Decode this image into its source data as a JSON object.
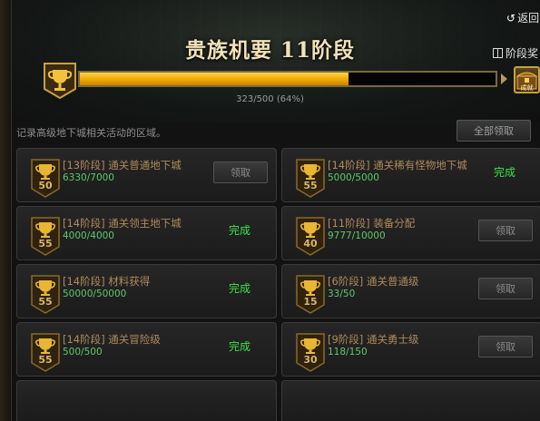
{
  "header": {
    "back_label": "返回",
    "back_icon": "return-arrow-icon",
    "title": "贵族机要 11阶段",
    "stage_reward_label": "阶段奖",
    "stage_reward_icon": "gift-icon"
  },
  "progress": {
    "current": 323,
    "total": 500,
    "fraction": 0.646,
    "text": "323/500 (64%)",
    "reward_box_label": "成就"
  },
  "description": "记录高级地下城相关活动的区域。",
  "claim_all_label": "全部领取",
  "colors": {
    "gold": "#f0a800",
    "done_green": "#3ee04a",
    "count_green": "#5ec86a",
    "name_brown": "#b08a5a"
  },
  "achievements": [
    {
      "level": "50",
      "name": "[13阶段] 通关普通地下城",
      "count": "6330/7000",
      "status": "领取"
    },
    {
      "level": "55",
      "name": "[14阶段] 通关稀有怪物地下城",
      "count": "5000/5000",
      "status": "完成"
    },
    {
      "level": "55",
      "name": "[14阶段] 通关领主地下城",
      "count": "4000/4000",
      "status": "完成"
    },
    {
      "level": "40",
      "name": "[11阶段] 装备分配",
      "count": "9777/10000",
      "status": "领取"
    },
    {
      "level": "55",
      "name": "[14阶段] 材料获得",
      "count": "50000/50000",
      "status": "完成"
    },
    {
      "level": "15",
      "name": "[6阶段] 通关普通级",
      "count": "33/50",
      "status": "领取"
    },
    {
      "level": "55",
      "name": "[14阶段] 通关冒险级",
      "count": "500/500",
      "status": "完成"
    },
    {
      "level": "30",
      "name": "[9阶段] 通关勇士级",
      "count": "118/150",
      "status": "领取"
    }
  ]
}
